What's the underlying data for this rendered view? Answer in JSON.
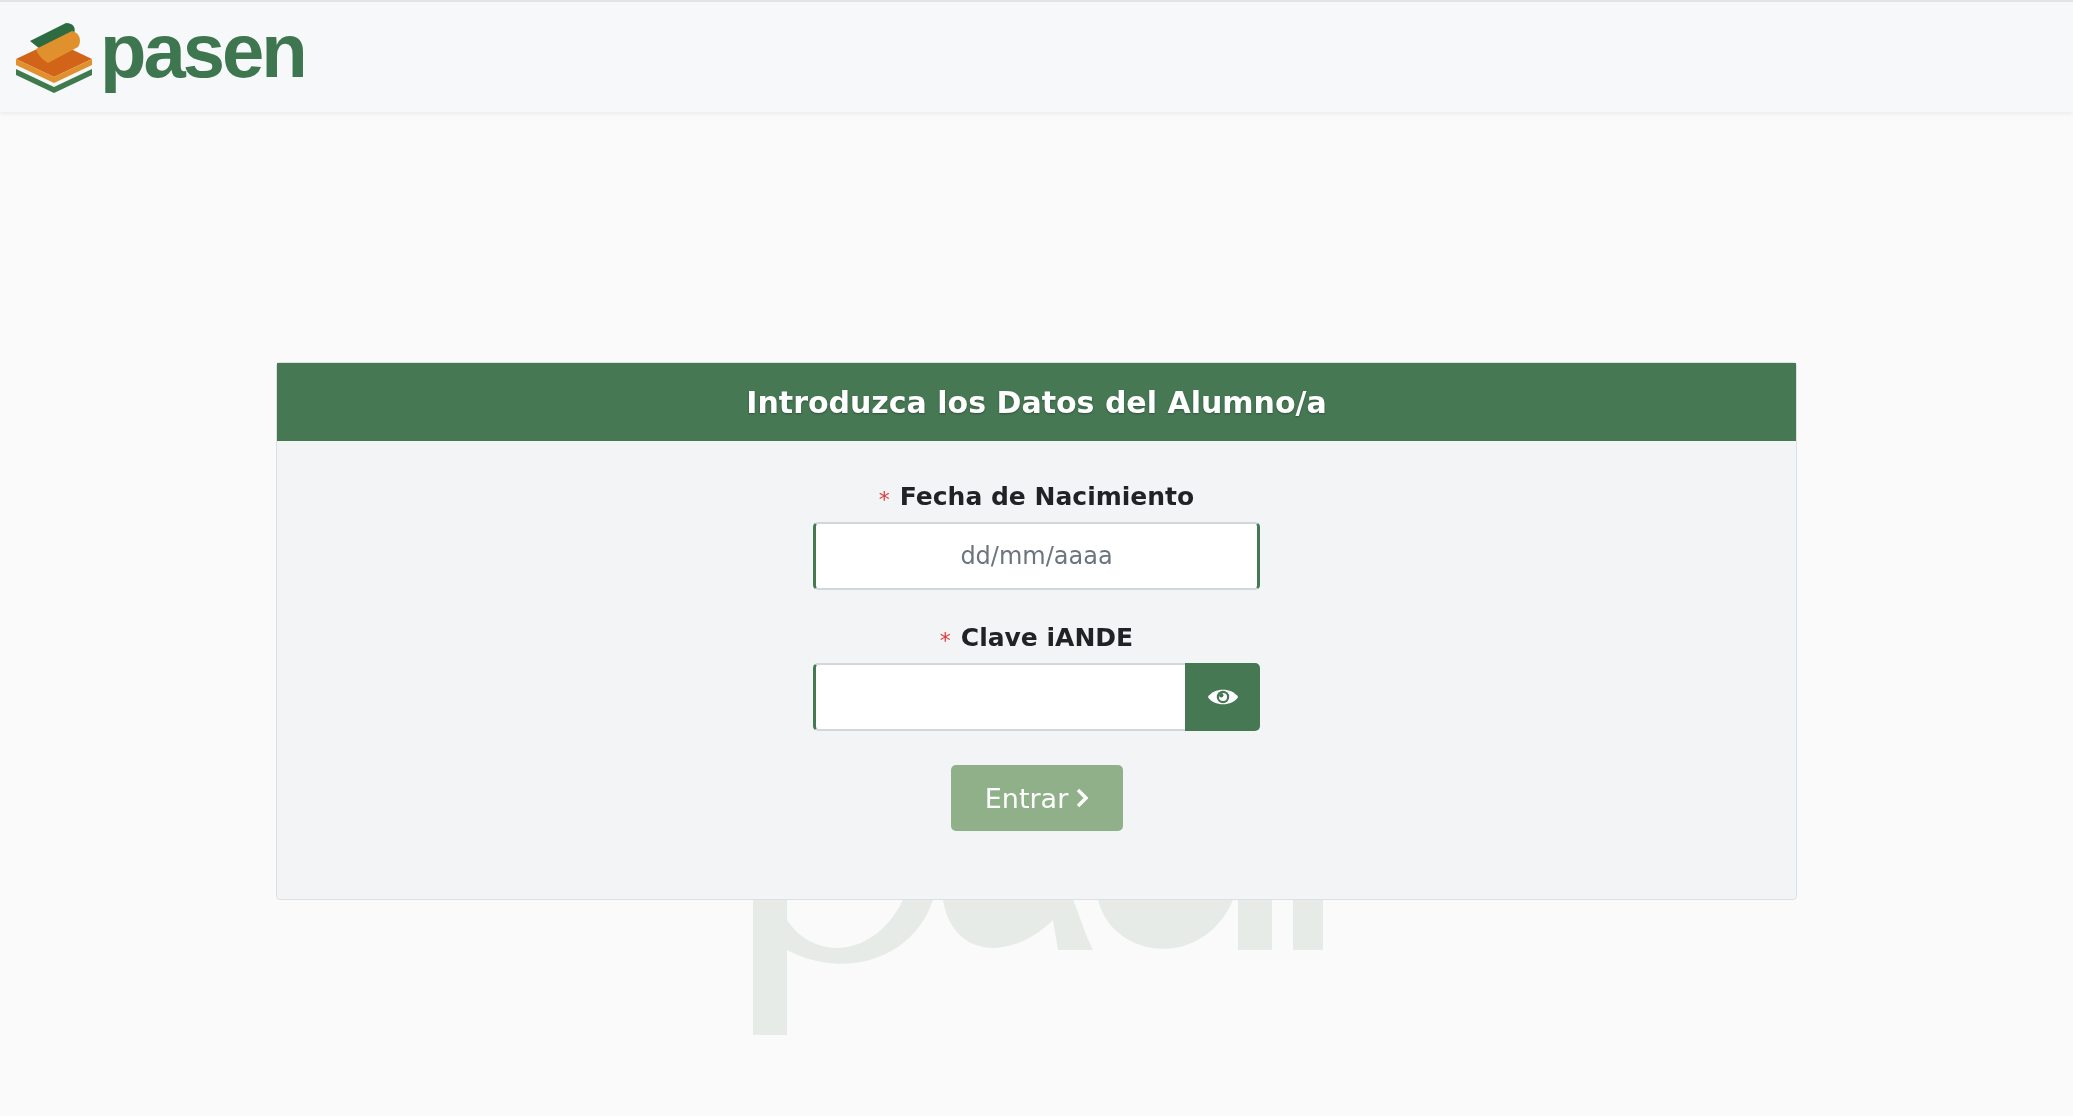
{
  "header": {
    "logo_text": "pasen"
  },
  "form": {
    "title": "Introduzca los Datos del Alumno/a",
    "fields": [
      {
        "kind": "date",
        "required": true,
        "required_mark": "*",
        "label": "Fecha de Nacimiento",
        "placeholder": "dd/mm/aaaa"
      },
      {
        "kind": "password",
        "required": true,
        "required_mark": "*",
        "label": "Clave iANDE"
      }
    ],
    "submit": {
      "label": "Entrar",
      "disabled": true
    }
  }
}
